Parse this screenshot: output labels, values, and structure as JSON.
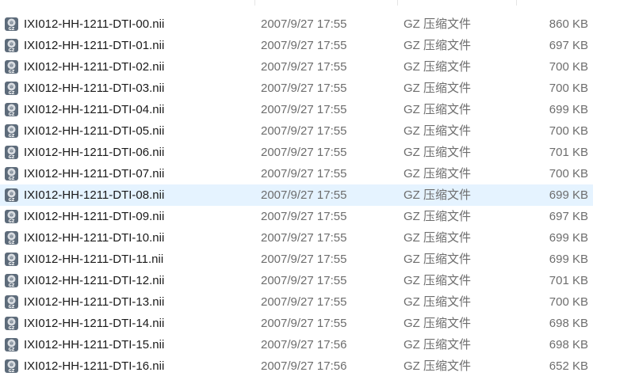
{
  "files": [
    {
      "name": "IXI012-HH-1211-DTI-00.nii",
      "date": "2007/9/27 17:55",
      "type": "GZ 压缩文件",
      "size": "860 KB",
      "icon": "gz-archive-icon"
    },
    {
      "name": "IXI012-HH-1211-DTI-01.nii",
      "date": "2007/9/27 17:55",
      "type": "GZ 压缩文件",
      "size": "697 KB",
      "icon": "gz-archive-icon"
    },
    {
      "name": "IXI012-HH-1211-DTI-02.nii",
      "date": "2007/9/27 17:55",
      "type": "GZ 压缩文件",
      "size": "700 KB",
      "icon": "gz-archive-icon"
    },
    {
      "name": "IXI012-HH-1211-DTI-03.nii",
      "date": "2007/9/27 17:55",
      "type": "GZ 压缩文件",
      "size": "700 KB",
      "icon": "gz-archive-icon"
    },
    {
      "name": "IXI012-HH-1211-DTI-04.nii",
      "date": "2007/9/27 17:55",
      "type": "GZ 压缩文件",
      "size": "699 KB",
      "icon": "gz-archive-icon"
    },
    {
      "name": "IXI012-HH-1211-DTI-05.nii",
      "date": "2007/9/27 17:55",
      "type": "GZ 压缩文件",
      "size": "700 KB",
      "icon": "gz-archive-icon"
    },
    {
      "name": "IXI012-HH-1211-DTI-06.nii",
      "date": "2007/9/27 17:55",
      "type": "GZ 压缩文件",
      "size": "701 KB",
      "icon": "gz-archive-icon"
    },
    {
      "name": "IXI012-HH-1211-DTI-07.nii",
      "date": "2007/9/27 17:55",
      "type": "GZ 压缩文件",
      "size": "700 KB",
      "icon": "gz-archive-icon"
    },
    {
      "name": "IXI012-HH-1211-DTI-08.nii",
      "date": "2007/9/27 17:55",
      "type": "GZ 压缩文件",
      "size": "699 KB",
      "icon": "gz-archive-icon",
      "selected": true
    },
    {
      "name": "IXI012-HH-1211-DTI-09.nii",
      "date": "2007/9/27 17:55",
      "type": "GZ 压缩文件",
      "size": "697 KB",
      "icon": "gz-archive-icon"
    },
    {
      "name": "IXI012-HH-1211-DTI-10.nii",
      "date": "2007/9/27 17:55",
      "type": "GZ 压缩文件",
      "size": "699 KB",
      "icon": "gz-archive-icon"
    },
    {
      "name": "IXI012-HH-1211-DTI-11.nii",
      "date": "2007/9/27 17:55",
      "type": "GZ 压缩文件",
      "size": "699 KB",
      "icon": "gz-archive-icon"
    },
    {
      "name": "IXI012-HH-1211-DTI-12.nii",
      "date": "2007/9/27 17:55",
      "type": "GZ 压缩文件",
      "size": "701 KB",
      "icon": "gz-archive-icon"
    },
    {
      "name": "IXI012-HH-1211-DTI-13.nii",
      "date": "2007/9/27 17:55",
      "type": "GZ 压缩文件",
      "size": "700 KB",
      "icon": "gz-archive-icon"
    },
    {
      "name": "IXI012-HH-1211-DTI-14.nii",
      "date": "2007/9/27 17:55",
      "type": "GZ 压缩文件",
      "size": "698 KB",
      "icon": "gz-archive-icon"
    },
    {
      "name": "IXI012-HH-1211-DTI-15.nii",
      "date": "2007/9/27 17:56",
      "type": "GZ 压缩文件",
      "size": "698 KB",
      "icon": "gz-archive-icon"
    },
    {
      "name": "IXI012-HH-1211-DTI-16.nii",
      "date": "2007/9/27 17:56",
      "type": "GZ 压缩文件",
      "size": "652 KB",
      "icon": "gz-archive-icon"
    }
  ],
  "icon_label": "GZ",
  "colors": {
    "selected_row": "#e5f3ff",
    "name_text": "#1a1a1a",
    "detail_text": "#6d6d6d",
    "icon_body": "#5d6b7a"
  }
}
